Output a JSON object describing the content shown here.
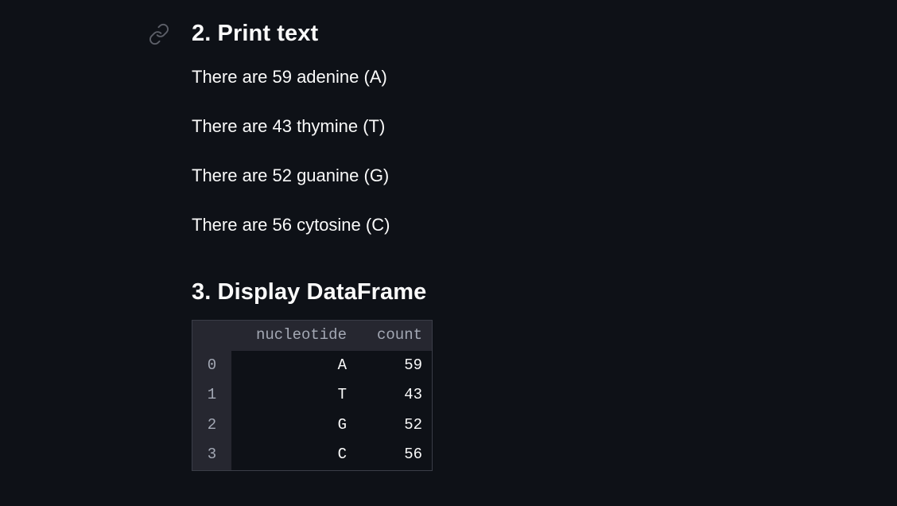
{
  "section2": {
    "title": "2. Print text",
    "lines": [
      "There are 59 adenine (A)",
      "There are 43 thymine (T)",
      "There are 52 guanine (G)",
      "There are 56 cytosine (C)"
    ]
  },
  "section3": {
    "title": "3. Display DataFrame"
  },
  "dataframe": {
    "columns": [
      "nucleotide",
      "count"
    ],
    "rows": [
      {
        "index": "0",
        "nucleotide": "A",
        "count": "59"
      },
      {
        "index": "1",
        "nucleotide": "T",
        "count": "43"
      },
      {
        "index": "2",
        "nucleotide": "G",
        "count": "52"
      },
      {
        "index": "3",
        "nucleotide": "C",
        "count": "56"
      }
    ]
  },
  "icons": {
    "anchor_link": "link-icon"
  },
  "colors": {
    "background": "#0e1117",
    "text": "#fafafa",
    "table_header": "#262730",
    "muted_text": "#a3a8b4"
  }
}
